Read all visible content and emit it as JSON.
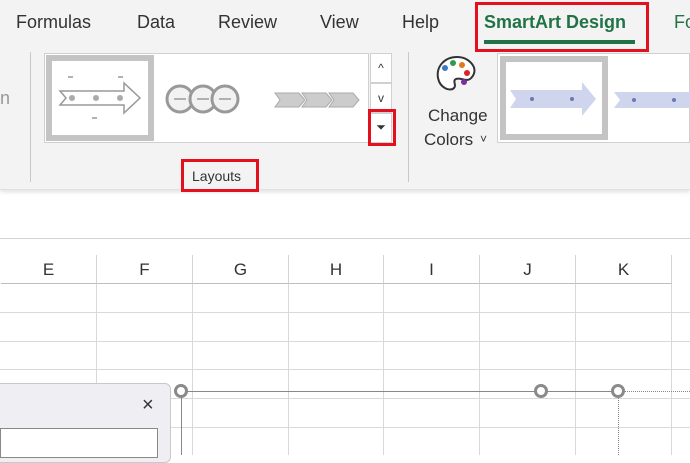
{
  "tabs": [
    {
      "label": "Formulas"
    },
    {
      "label": "Data"
    },
    {
      "label": "Review"
    },
    {
      "label": "View"
    },
    {
      "label": "Help"
    },
    {
      "label": "SmartArt Design"
    },
    {
      "label": "Fo"
    }
  ],
  "left_cut_label": "n",
  "layouts": {
    "label": "Layouts",
    "gallery": [
      "Basic Timeline",
      "Circle Accent Timeline",
      "Chevron Accent Process"
    ],
    "scroll_up": "^",
    "scroll_down": "v",
    "more": "more"
  },
  "change_colors": {
    "line1": "Change",
    "line2": "Colors",
    "chevron": "˅"
  },
  "columns": [
    "E",
    "F",
    "G",
    "H",
    "I",
    "J",
    "K"
  ],
  "pane": {
    "close": "×"
  },
  "colors": {
    "accent": "#217346",
    "highlight": "#e5101e"
  }
}
